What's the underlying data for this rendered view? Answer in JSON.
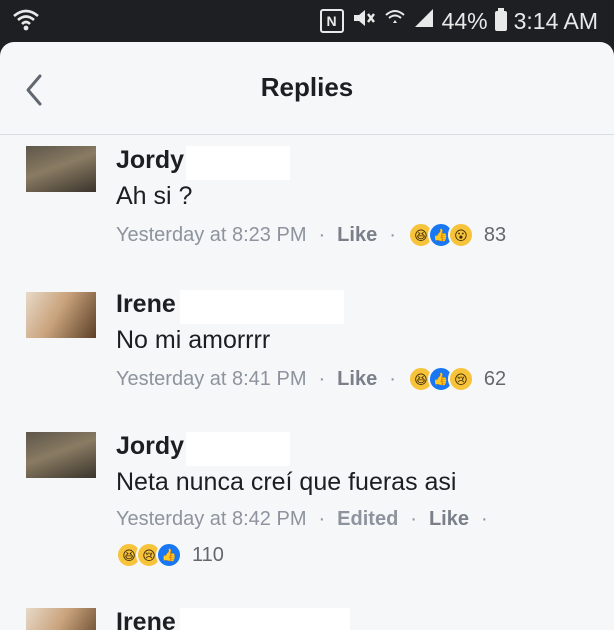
{
  "status_bar": {
    "battery": "44%",
    "time": "3:14 AM",
    "nfc_label": "N"
  },
  "header": {
    "title": "Replies"
  },
  "replies": [
    {
      "author": "Jordy",
      "text": "Ah si ?",
      "time": "Yesterday at 8:23 PM",
      "like_label": "Like",
      "reactions": [
        "haha",
        "like",
        "wow"
      ],
      "reaction_count": "83"
    },
    {
      "author": "Irene",
      "text": "No mi amorrrr",
      "time": "Yesterday at 8:41 PM",
      "like_label": "Like",
      "reactions": [
        "haha",
        "like",
        "sad"
      ],
      "reaction_count": "62"
    },
    {
      "author": "Jordy",
      "text": "Neta nunca creí  que fueras asi",
      "time": "Yesterday at 8:42 PM",
      "edited_label": "Edited",
      "like_label": "Like",
      "reactions": [
        "haha",
        "sad",
        "like"
      ],
      "reaction_count": "110"
    },
    {
      "author": "Irene"
    }
  ],
  "icons": {
    "haha": "😆",
    "like": "👍",
    "wow": "😮",
    "sad": "😢"
  }
}
